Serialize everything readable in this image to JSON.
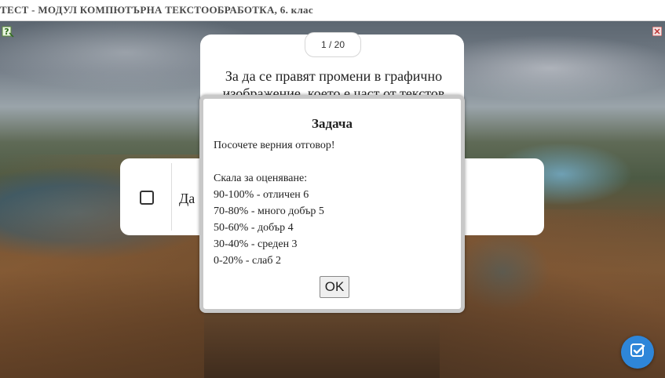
{
  "window": {
    "title": "ТЕСТ - МОДУЛ КОМПЮТЪРНА ТЕКСТООБРАБОТКА, 6. клас"
  },
  "quiz": {
    "counter": "1 / 20",
    "question_line1": "За да се правят промени в графично",
    "question_line2": "изображение, което е част от текстов",
    "answer_visible": "Да"
  },
  "dialog": {
    "title": "Задача",
    "lines": [
      "Посочете верния отговор!",
      "",
      "Скала за оценяване:",
      "90-100% - отличен 6",
      "70-80% - много добър 5",
      "50-60% - добър 4",
      "30-40% - среден 3",
      "0-20% - слаб 2"
    ],
    "ok_label": "OK"
  },
  "colors": {
    "accent": "#2e86d9",
    "dialog_border": "#c8c8c8"
  },
  "icons": {
    "help": "help-question-icon",
    "close": "close-x-icon",
    "check": "check-submit-icon"
  }
}
